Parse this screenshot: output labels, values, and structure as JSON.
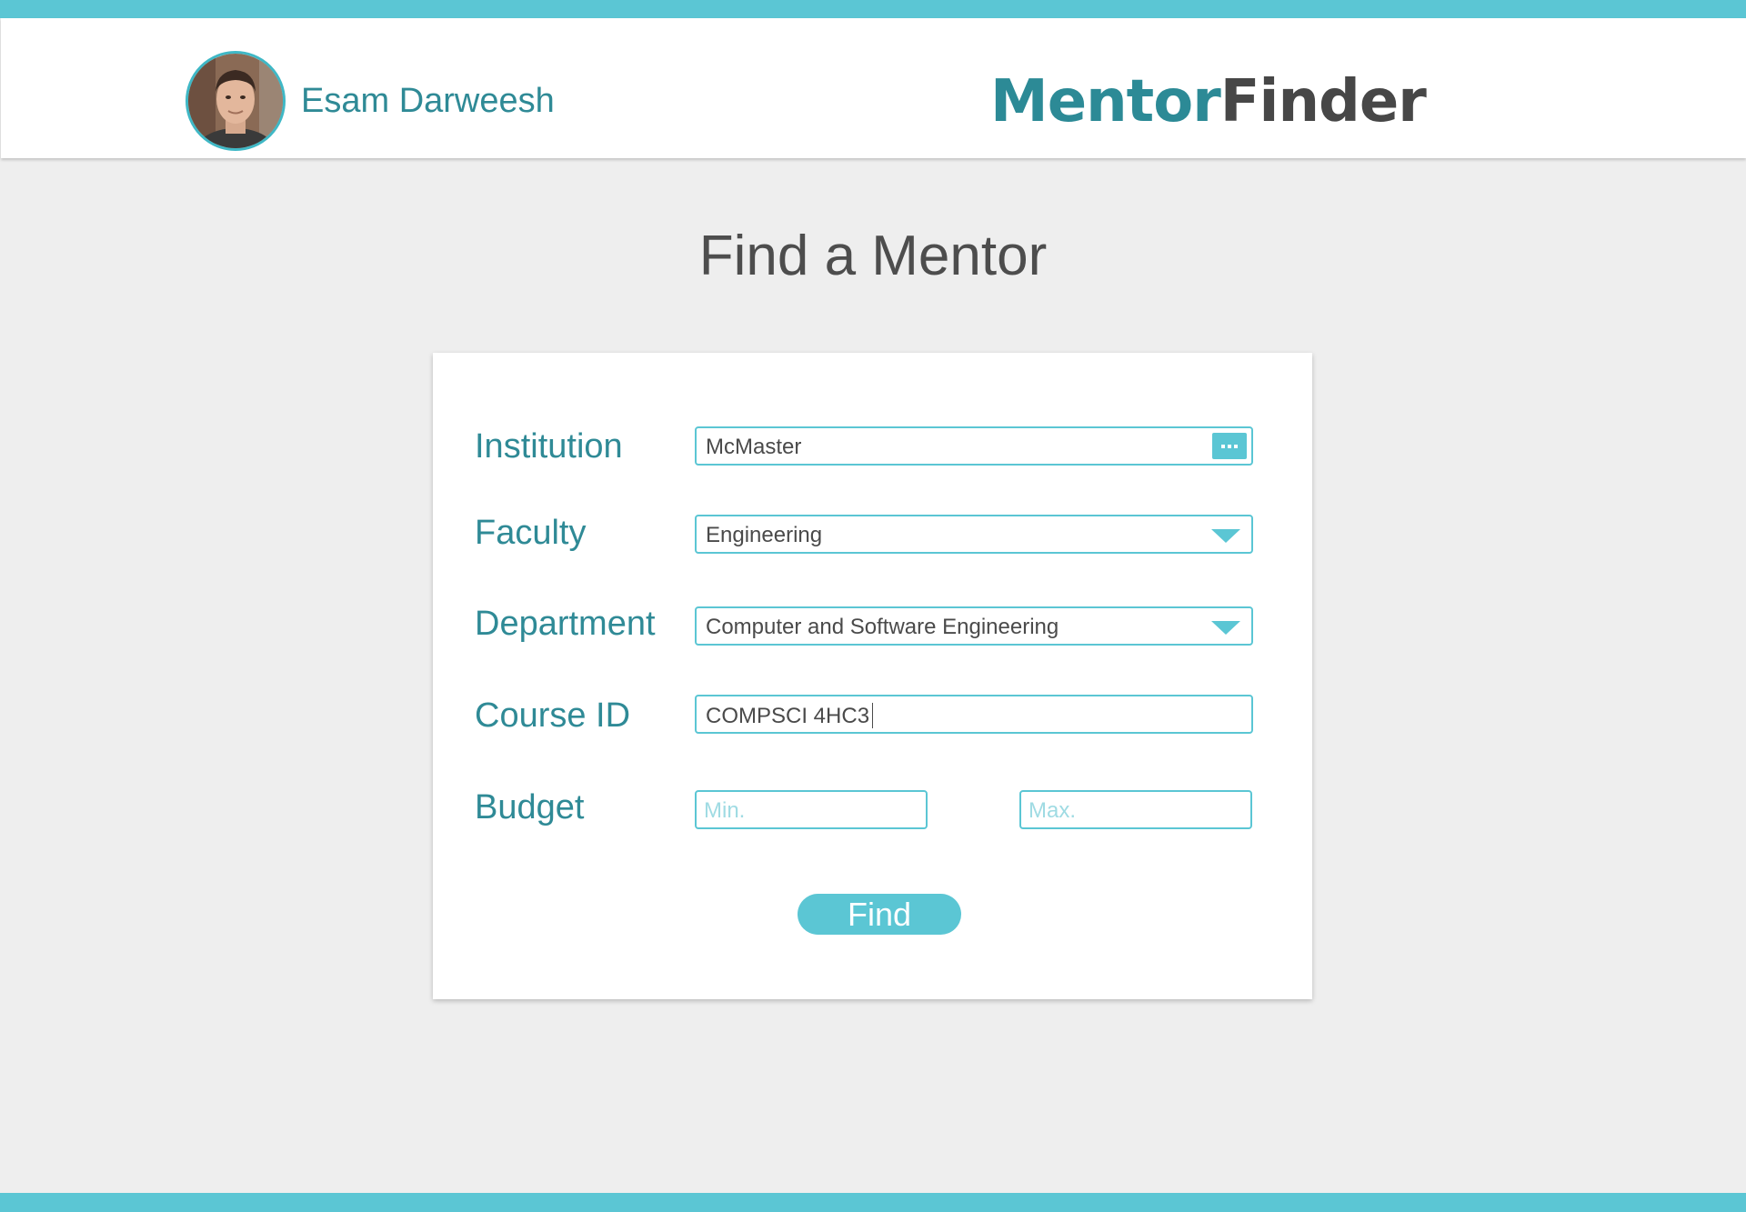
{
  "header": {
    "user_name": "Esam Darweesh",
    "logo_part1": "Mentor",
    "logo_part2": "Finder"
  },
  "page": {
    "title": "Find a Mentor"
  },
  "form": {
    "institution": {
      "label": "Institution",
      "value": "McMaster",
      "icon": "more-dots-icon"
    },
    "faculty": {
      "label": "Faculty",
      "value": "Engineering",
      "icon": "chevron-down-icon"
    },
    "department": {
      "label": "Department",
      "value": "Computer and Software Engineering",
      "icon": "chevron-down-icon"
    },
    "course": {
      "label": "Course ID",
      "value": "COMPSCI 4HC3"
    },
    "budget": {
      "label": "Budget",
      "min_placeholder": "Min.",
      "max_placeholder": "Max."
    },
    "find_label": "Find"
  },
  "colors": {
    "accent": "#5bc6d4",
    "label_teal": "#2f8a96",
    "background": "#eeeeee"
  }
}
